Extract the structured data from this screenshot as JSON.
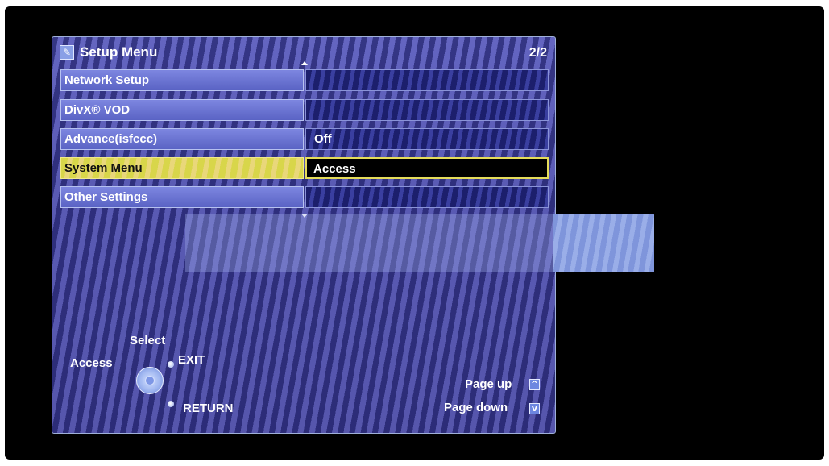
{
  "header": {
    "title": "Setup Menu",
    "page": "2/2",
    "icon": "setup-icon"
  },
  "menu": [
    {
      "label": "Network Setup",
      "value": ""
    },
    {
      "label": "DivX® VOD",
      "value": ""
    },
    {
      "label": "Advance(isfccc)",
      "value": "Off"
    },
    {
      "label": "System Menu",
      "value": "Access",
      "selected": true
    },
    {
      "label": "Other Settings",
      "value": ""
    }
  ],
  "help": {
    "select": "Select",
    "access": "Access",
    "exit": "EXIT",
    "return": "RETURN",
    "page_up": "Page up",
    "page_down": "Page down"
  },
  "colors": {
    "highlight": "#d8d64a",
    "panel": "#4f50a6"
  }
}
